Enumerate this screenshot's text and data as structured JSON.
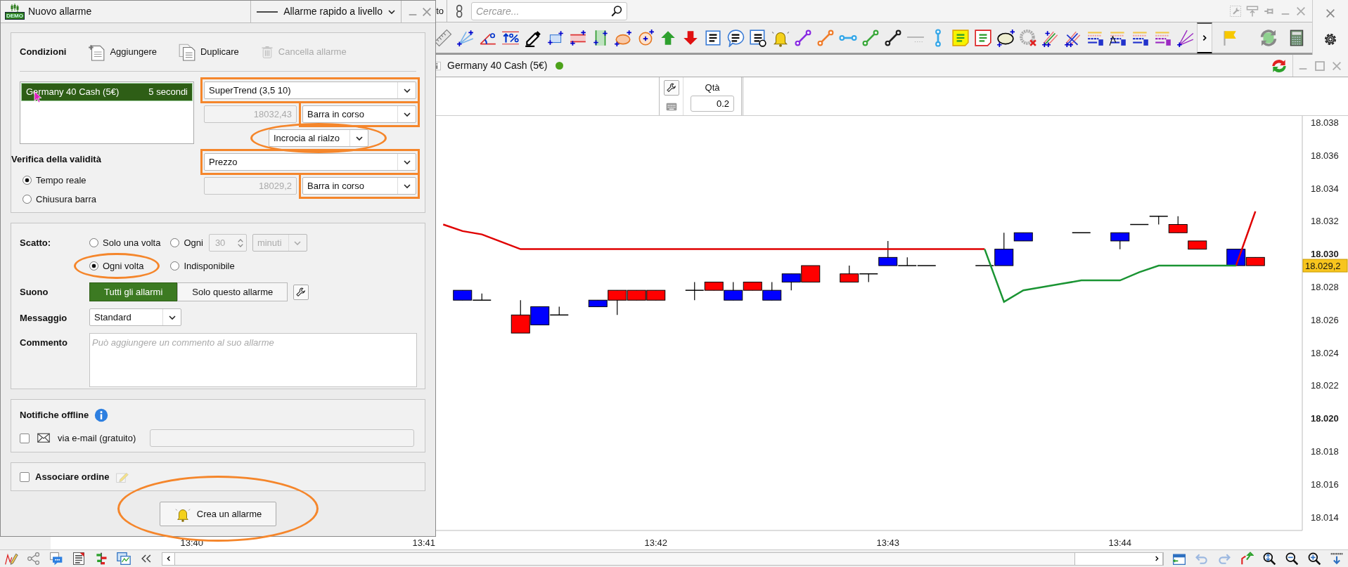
{
  "dialog": {
    "logo_text": "DEMO",
    "title": "Nuovo allarme",
    "quick_alert": "Allarme rapido a livello",
    "conditions": {
      "heading": "Condizioni",
      "actions": [
        {
          "label": "Aggiungere",
          "kind": "add",
          "disabled": false
        },
        {
          "label": "Duplicare",
          "kind": "duplicate",
          "disabled": false
        },
        {
          "label": "Cancella allarme",
          "kind": "delete",
          "disabled": true
        }
      ],
      "items": [
        {
          "name": "Germany 40 Cash (5€)",
          "timeframe": "5 secondi",
          "selected": true
        }
      ],
      "indicator": {
        "value": "SuperTrend (3,5 10)",
        "framed": true
      },
      "indicator_level": {
        "value": "18032,43",
        "disabled": true,
        "bar": "Barra in corso",
        "framed": true
      },
      "operator": {
        "value": "Incrocia al rialzo",
        "circled": true
      },
      "target": {
        "value": "Prezzo",
        "framed": true
      },
      "target_level": {
        "value": "18029,2",
        "disabled": true,
        "bar": "Barra in corso",
        "framed": true
      }
    },
    "validity": {
      "heading": "Verifica della validità",
      "options": [
        {
          "label": "Tempo reale",
          "selected": true
        },
        {
          "label": "Chiusura barra",
          "selected": false
        }
      ]
    },
    "trigger": {
      "label": "Scatto:",
      "options": [
        {
          "label": "Solo una volta",
          "selected": false
        },
        {
          "label": "Ogni",
          "selected": false
        },
        {
          "label": "Ogni volta",
          "selected": true,
          "circled": true
        },
        {
          "label": "Indisponibile",
          "selected": false
        }
      ],
      "interval": {
        "value": "30",
        "unit": "minuti",
        "disabled": true
      }
    },
    "sound": {
      "label": "Suono",
      "options": [
        {
          "label": "Tutti gli allarmi",
          "selected": true
        },
        {
          "label": "Solo questo allarme",
          "selected": false
        }
      ]
    },
    "message": {
      "label": "Messaggio",
      "value": "Standard"
    },
    "comment": {
      "label": "Commento",
      "placeholder": "Può aggiungere un commento al suo allarme"
    },
    "offline": {
      "heading": "Notifiche offline",
      "email": {
        "label": "via e-mail (gratuito)",
        "checked": false
      }
    },
    "order": {
      "label": "Associare ordine",
      "checked": false
    },
    "create_button": {
      "label": "Crea un allarme",
      "circled": true
    }
  },
  "topbar": {
    "cut_text": "to",
    "search": {
      "placeholder": "Cercare..."
    }
  },
  "chart_window": {
    "title": "Germany 40 Cash (5€)",
    "online": true,
    "order_panel": {
      "qty_label": "Qtà",
      "qty": "0.2"
    },
    "chart_data": {
      "type": "line",
      "ylim": [
        18013.2,
        18038.4
      ],
      "categories": [
        "13:40",
        null,
        null,
        null,
        null,
        null,
        null,
        null,
        null,
        null,
        null,
        null,
        "13:41",
        null,
        null,
        null,
        null,
        null,
        null,
        null,
        null,
        null,
        null,
        null,
        "13:42",
        null,
        null,
        null,
        null,
        null,
        null,
        null,
        null,
        null,
        null,
        null,
        "13:43",
        null,
        null,
        null,
        null,
        null,
        null,
        null,
        null,
        null,
        null,
        null,
        "13:44",
        null,
        null,
        null,
        null,
        null,
        null,
        null,
        null
      ],
      "yticks": [
        {
          "value": 18038,
          "label": "18.038"
        },
        {
          "value": 18036,
          "label": "18.036"
        },
        {
          "value": 18034,
          "label": "18.034"
        },
        {
          "value": 18032,
          "label": "18.032"
        },
        {
          "value": 18030,
          "label": "18.030"
        },
        {
          "value": 18028,
          "label": "18.028"
        },
        {
          "value": 18026,
          "label": "18.026"
        },
        {
          "value": 18024,
          "label": "18.024"
        },
        {
          "value": 18022,
          "label": "18.022"
        },
        {
          "value": 18020,
          "label": "18.020"
        },
        {
          "value": 18018,
          "label": "18.018"
        },
        {
          "value": 18016,
          "label": "18.016"
        },
        {
          "value": 18014,
          "label": "18.014"
        }
      ],
      "series": [
        {
          "color": "#e00000",
          "values": [
            null,
            null,
            null,
            null,
            null,
            null,
            null,
            null,
            null,
            null,
            null,
            null,
            null,
            18031.8,
            18031.4,
            18031.2,
            18030.75,
            18030.3,
            18030.3,
            18030.3,
            18030.3,
            18030.3,
            18030.3,
            18030.3,
            18030.3,
            18030.3,
            18030.3,
            18030.3,
            18030.3,
            18030.3,
            18030.3,
            18030.3,
            18030.3,
            18030.3,
            18030.3,
            18030.3,
            18030.3,
            18030.3,
            18030.3,
            18030.3,
            18030.3,
            18030.3,
            null,
            null,
            null,
            null,
            null,
            null,
            null,
            null,
            null,
            null,
            null,
            null,
            18029.3,
            18032.6,
            null
          ]
        },
        {
          "color": "#1a9433",
          "values": [
            null,
            null,
            null,
            null,
            null,
            null,
            null,
            null,
            null,
            null,
            null,
            null,
            null,
            null,
            null,
            null,
            null,
            null,
            null,
            null,
            null,
            null,
            null,
            null,
            null,
            null,
            null,
            null,
            null,
            null,
            null,
            null,
            null,
            null,
            null,
            null,
            null,
            null,
            null,
            null,
            null,
            18030.3,
            18027.1,
            18027.8,
            18028.0,
            18028.2,
            18028.4,
            18028.4,
            18028.4,
            18028.9,
            18029.3,
            18029.3,
            18029.3,
            18029.3,
            18029.3,
            null,
            null
          ]
        }
      ],
      "annotations": [
        "18.029,2"
      ]
    }
  }
}
